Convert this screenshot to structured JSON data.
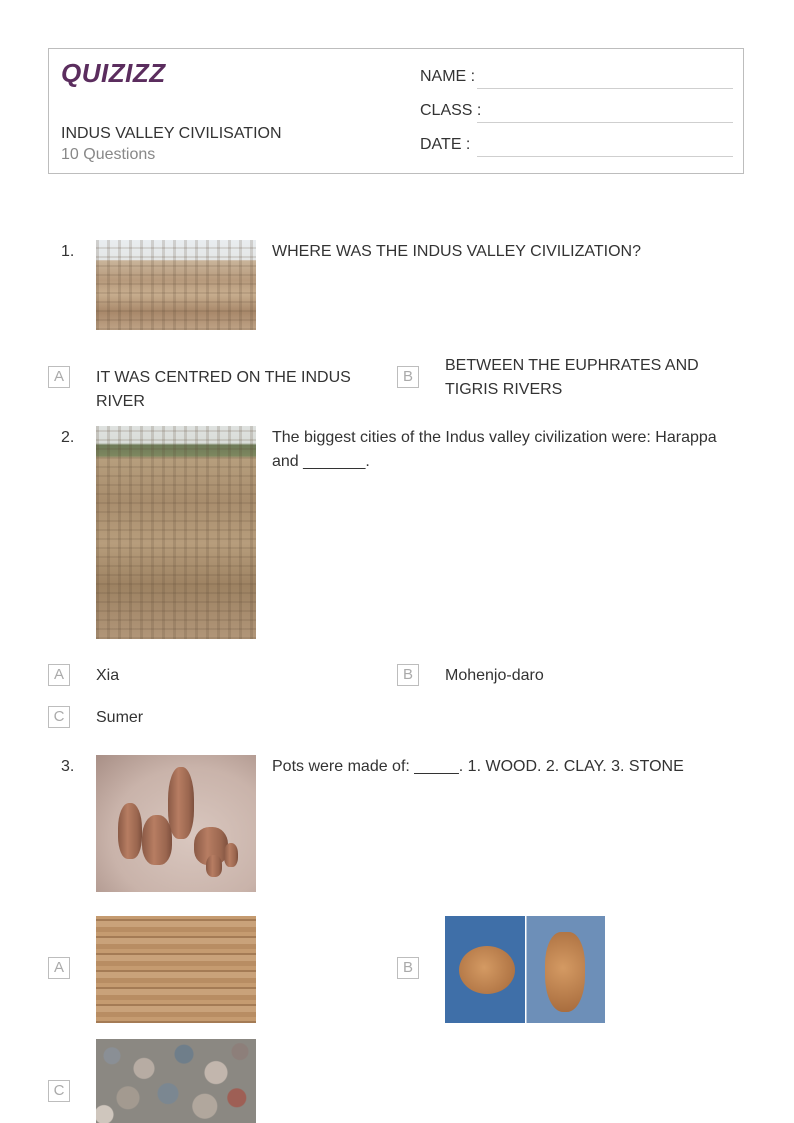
{
  "brand": {
    "logo_text": "QUIZIZZ"
  },
  "worksheet": {
    "title": "INDUS VALLEY CIVILISATION",
    "subtitle": "10 Questions"
  },
  "fields": {
    "name_label": "NAME :",
    "class_label": "CLASS :",
    "date_label": "DATE  :"
  },
  "questions": [
    {
      "number": "1.",
      "text": "WHERE WAS THE INDUS VALLEY CIVILIZATION?",
      "image": "indus-ruins-photo",
      "options": [
        {
          "letter": "A",
          "text": "IT WAS CENTRED ON THE INDUS RIVER"
        },
        {
          "letter": "B",
          "text": "BETWEEN THE EUPHRATES AND TIGRIS RIVERS"
        }
      ]
    },
    {
      "number": "2.",
      "text": "The biggest cities of the Indus valley civilization were: Harappa and _______.",
      "image": "mohenjo-daro-excavation-photo",
      "options": [
        {
          "letter": "A",
          "text": "Xia"
        },
        {
          "letter": "B",
          "text": "Mohenjo-daro"
        },
        {
          "letter": "C",
          "text": "Sumer"
        }
      ]
    },
    {
      "number": "3.",
      "text": "Pots were made of: _____. 1. WOOD. 2. CLAY. 3. STONE",
      "image": "clay-pots-photo",
      "options": [
        {
          "letter": "A",
          "image": "wood-planks-photo"
        },
        {
          "letter": "B",
          "image": "pottery-making-photo"
        },
        {
          "letter": "C",
          "image": "pebbles-photo"
        }
      ]
    }
  ]
}
